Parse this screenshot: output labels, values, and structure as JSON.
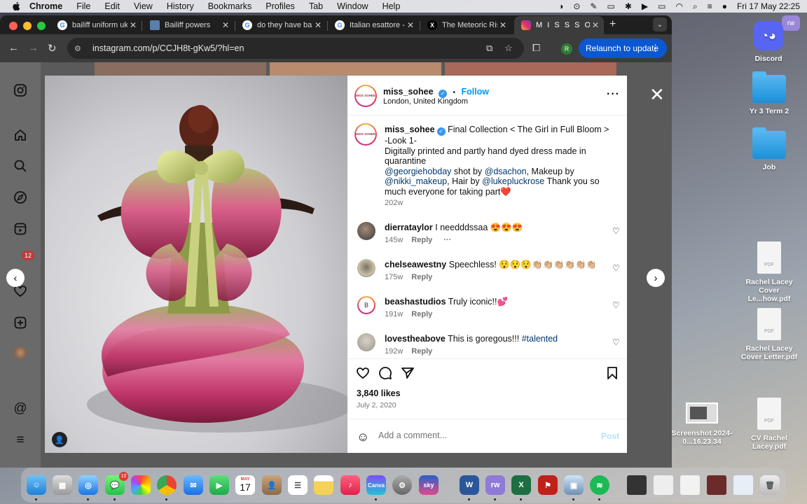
{
  "menubar": {
    "app": "Chrome",
    "items": [
      "File",
      "Edit",
      "View",
      "History",
      "Bookmarks",
      "Profiles",
      "Tab",
      "Window",
      "Help"
    ],
    "datetime": "Fri 17 May  22:25"
  },
  "tabs": [
    {
      "title": "bailiff uniform uk",
      "favicon": "G"
    },
    {
      "title": "Bailiff powers",
      "favicon": "doc"
    },
    {
      "title": "do they have bail",
      "favicon": "G"
    },
    {
      "title": "Italian esattore -",
      "favicon": "G"
    },
    {
      "title": "The Meteoric Rise",
      "favicon": "X"
    },
    {
      "title": "M I S S S O H E E",
      "favicon": "ig"
    }
  ],
  "toolbar": {
    "url": "instagram.com/p/CCJH8t-gKw5/?hl=en",
    "profile_initial": "R",
    "relaunch_label": "Relaunch to update"
  },
  "instagram": {
    "notif_count": "12",
    "post": {
      "username": "miss_sohee",
      "follow_label": "Follow",
      "location": "London, United Kingdom",
      "logo_text": "MISS SOHEE",
      "caption": {
        "username": "miss_sohee",
        "line1": "Final Collection < The Girl in Full Bloom >",
        "line2": "-Look 1-",
        "line3": "Digitally printed and partly hand dyed dress made in quarantine",
        "mention1": "@georgiehobday",
        "t1": " shot by ",
        "mention2": "@dsachon",
        "t2": ", Makeup by ",
        "mention3": "@nikki_makeup",
        "t3": ", Hair by ",
        "mention4": "@lukepluckrose",
        "t4": " Thank you so much everyone for taking part❤️",
        "time": "202w"
      },
      "comments": [
        {
          "user": "dierrataylor",
          "text": "I needddssaa 😍😍😍",
          "time": "145w",
          "reply": "Reply",
          "more": "···"
        },
        {
          "user": "chelseawestny",
          "text": "Speechless! 😯😯😯👏🏼👏🏼👏🏼👏🏼👏🏼👏🏼👏🏼👏🏼",
          "time": "175w",
          "reply": "Reply"
        },
        {
          "user": "beashastudios",
          "text": "Truly iconic!!💕",
          "time": "191w",
          "reply": "Reply"
        },
        {
          "user": "lovestheabove",
          "text": "This is goregous!!! ",
          "hashtag": "#talented",
          "time": "192w",
          "reply": "Reply"
        }
      ],
      "likes": "3,840 likes",
      "date": "July 2, 2020",
      "comment_placeholder": "Add a comment...",
      "post_label": "Post"
    }
  },
  "desktop": [
    {
      "label": "Discord",
      "type": "app"
    },
    {
      "label": "Yr 3 Term 2",
      "type": "folder"
    },
    {
      "label": "Job",
      "type": "folder"
    },
    {
      "label": "Rachel Lacey Cover Le...how.pdf",
      "type": "pdf"
    },
    {
      "label": "Rachel Lacey Cover Letter.pdf",
      "type": "pdf"
    },
    {
      "label": "Screenshot 2024-0...16.23.34",
      "type": "image"
    },
    {
      "label": "CV Rachel Lacey.pdf",
      "type": "pdf"
    }
  ],
  "dock": {
    "messages_badge": "10",
    "calendar_month": "MAY",
    "calendar_day": "17",
    "canva_label": "Canva",
    "sky_label": "sky",
    "word_label": "W",
    "excel_label": "X",
    "rw_label": "rw"
  },
  "colors": {
    "instagram_blue": "#0095f6",
    "chrome_relaunch": "#0b57d0",
    "chrome_dark": "#1f1f1f"
  }
}
